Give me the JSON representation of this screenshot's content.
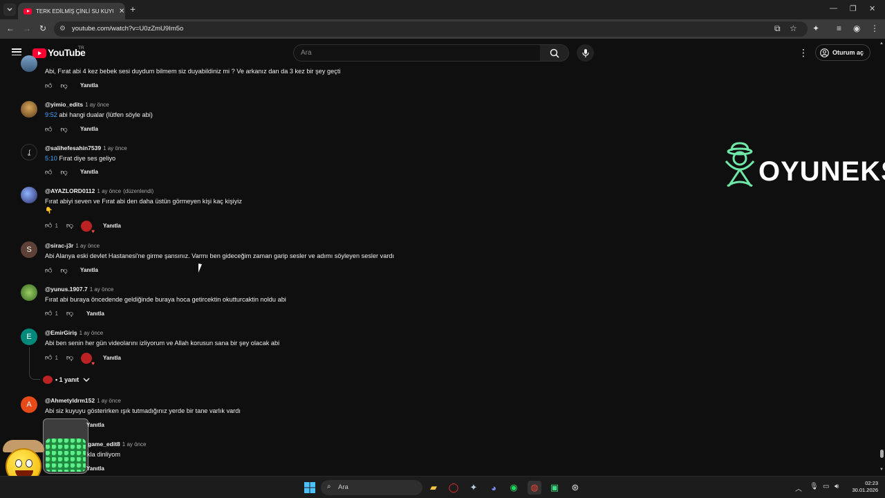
{
  "browser": {
    "tab_title": "TERK EDİLMİŞ ÇİNLİ SU KUYUSU",
    "url": "youtube.com/watch?v=U0zZmU9Im5o"
  },
  "youtube": {
    "logo": "YouTube",
    "country": "TR",
    "search_placeholder": "Ara",
    "signin_label": "Oturum aç"
  },
  "comments": [
    {
      "author": "",
      "time": "",
      "edited": "",
      "timestamp": "",
      "text": "Abi, Fırat abi 4 kez bebek sesi duydum bilmem siz duyabildiniz mi ? Ve arkanız dan da 3 kez bir şey geçti",
      "likes": "",
      "reply": "Yanıtla"
    },
    {
      "author": "@yimio_edits",
      "time": "1 ay önce",
      "edited": "",
      "timestamp": "9:52",
      "text": " abi hangi dualar (lütfen söyle abi)",
      "likes": "",
      "reply": "Yanıtla"
    },
    {
      "author": "@salihefesahin7539",
      "time": "1 ay önce",
      "edited": "",
      "timestamp": "5:10",
      "text": " Fırat diye ses geliyo",
      "likes": "",
      "reply": "Yanıtla"
    },
    {
      "author": "@AYAZLORD0112",
      "time": "1 ay önce",
      "edited": "(düzenlendi)",
      "timestamp": "",
      "text": "Fırat abiyi seven ve Fırat abi den daha üstün görmeyen kişi kaç kişiyiz",
      "likes": "1",
      "reply": "Yanıtla"
    },
    {
      "author": "@sirac-j3r",
      "time": "1 ay önce",
      "edited": "",
      "timestamp": "",
      "text": "Abi Alanya eski devlet Hastanesi'ne girme şansınız. Varmı ben gideceğim zaman garip sesler ve adımı söyleyen sesler vardı",
      "likes": "",
      "reply": "Yanıtla"
    },
    {
      "author": "@yunus.1907.7",
      "time": "1 ay önce",
      "edited": "",
      "timestamp": "",
      "text": "Fırat abi buraya öncedende geldiğinde buraya hoca getircektin okutturcaktin noldu abi",
      "likes": "1",
      "reply": "Yanıtla"
    },
    {
      "author": "@EmirGiriş",
      "time": "1 ay önce",
      "edited": "",
      "timestamp": "",
      "text": "Abi ben senin her gün videolarını izliyorum ve Allah korusun sana bir şey olacak abi",
      "likes": "1",
      "reply": "Yanıtla"
    },
    {
      "author": "@Ahmetyldrm152",
      "time": "1 ay önce",
      "edited": "",
      "timestamp": "",
      "text": "Abi siz kuyuyu gösterirken ışık tutmadığınız yerde bir tane varlık vardı",
      "likes": "",
      "reply": "Yanıtla"
    },
    {
      "author": "game_edit8",
      "time": "1 ay önce",
      "edited": "",
      "timestamp": "",
      "text": "kla dinliyom",
      "likes": "",
      "reply": "Yanıtla"
    }
  ],
  "avatar_letters": {
    "sirac": "S",
    "emir": "E",
    "ahmet": "A"
  },
  "emoji_line": "👇",
  "replies_toggle": "• 1 yanıt",
  "watermark": "OYUNEKS",
  "taskbar": {
    "search_label": "Ara",
    "time": "02:23",
    "date": "30.01.2026"
  },
  "colors": {
    "accent_red": "#ff0033",
    "link_blue": "#3ea6ff",
    "watermark_green": "#6ee7a8"
  }
}
